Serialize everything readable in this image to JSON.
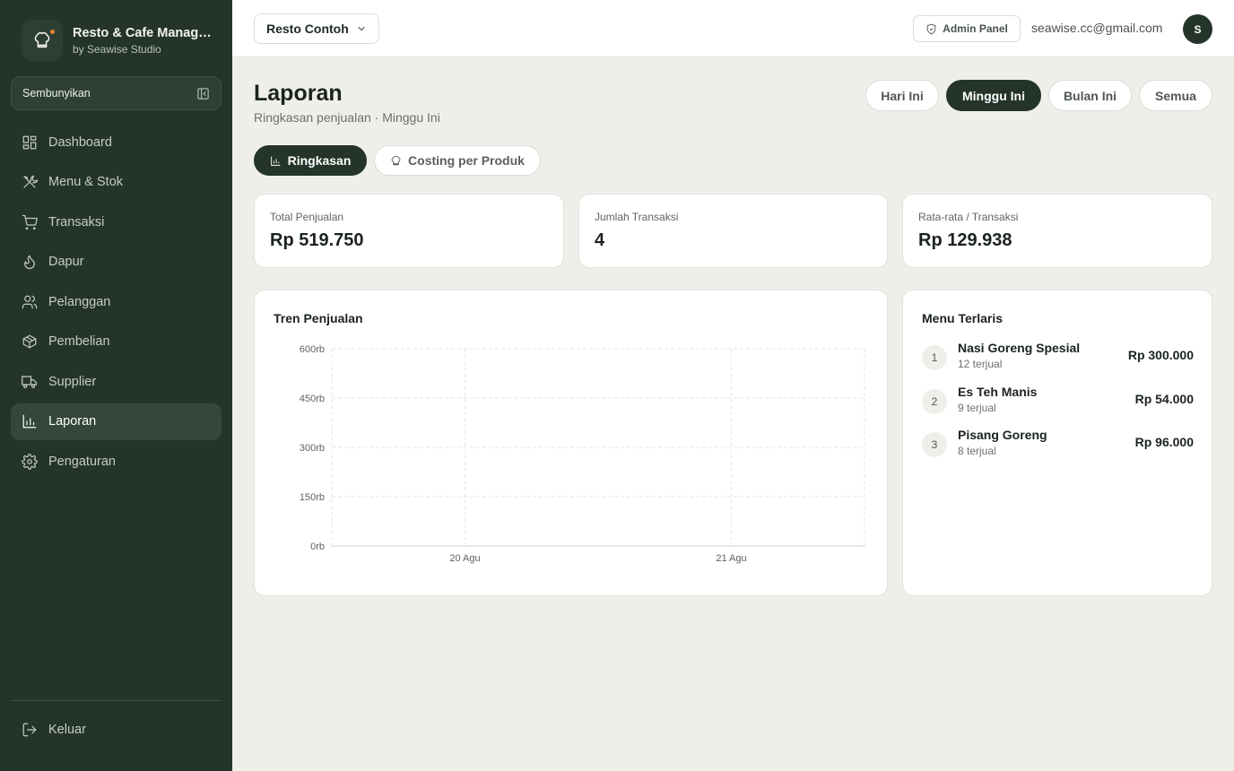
{
  "app": {
    "title": "Resto & Cafe Management",
    "subtitle": "by Seawise Studio",
    "accent": "#24342a"
  },
  "sidebar": {
    "collapse_label": "Sembunyikan",
    "items": [
      {
        "label": "Dashboard",
        "icon": "dashboard-icon"
      },
      {
        "label": "Menu & Stok",
        "icon": "utensils-icon"
      },
      {
        "label": "Transaksi",
        "icon": "cart-icon"
      },
      {
        "label": "Dapur",
        "icon": "flame-icon"
      },
      {
        "label": "Pelanggan",
        "icon": "users-icon"
      },
      {
        "label": "Pembelian",
        "icon": "package-icon"
      },
      {
        "label": "Supplier",
        "icon": "truck-icon"
      },
      {
        "label": "Laporan",
        "icon": "chart-icon",
        "active": true
      },
      {
        "label": "Pengaturan",
        "icon": "gear-icon"
      }
    ],
    "logout_label": "Keluar"
  },
  "topbar": {
    "resto_name": "Resto Contoh",
    "admin_label": "Admin Panel",
    "email": "seawise.cc@gmail.com",
    "avatar_initial": "S"
  },
  "page": {
    "title": "Laporan",
    "subtitle": "Ringkasan penjualan · Minggu Ini",
    "ranges": [
      "Hari Ini",
      "Minggu Ini",
      "Bulan Ini",
      "Semua"
    ],
    "active_range": "Minggu Ini",
    "views": [
      "Ringkasan",
      "Costing per Produk"
    ],
    "active_view": "Ringkasan"
  },
  "stats": [
    {
      "label": "Total Penjualan",
      "value": "Rp 519.750"
    },
    {
      "label": "Jumlah Transaksi",
      "value": "4"
    },
    {
      "label": "Rata-rata / Transaksi",
      "value": "Rp 129.938"
    }
  ],
  "trend": {
    "title": "Tren Penjualan"
  },
  "chart_data": {
    "type": "line",
    "title": "Tren Penjualan",
    "x": [
      "20 Agu",
      "21 Agu"
    ],
    "series": [],
    "ylim": [
      0,
      600
    ],
    "yticks": [
      "0rb",
      "150rb",
      "300rb",
      "450rb",
      "600rb"
    ],
    "grid": true
  },
  "top_menu": {
    "title": "Menu Terlaris",
    "items": [
      {
        "rank": "1",
        "name": "Nasi Goreng Spesial",
        "sold": "12 terjual",
        "total": "Rp 300.000"
      },
      {
        "rank": "2",
        "name": "Es Teh Manis",
        "sold": "9 terjual",
        "total": "Rp 54.000"
      },
      {
        "rank": "3",
        "name": "Pisang Goreng",
        "sold": "8 terjual",
        "total": "Rp 96.000"
      }
    ]
  }
}
